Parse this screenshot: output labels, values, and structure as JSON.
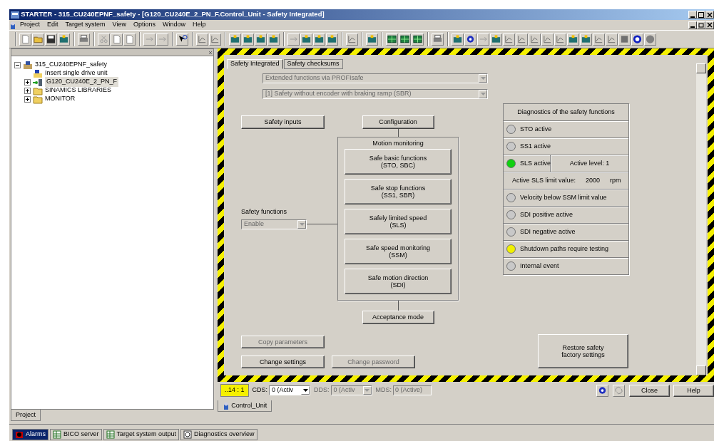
{
  "window": {
    "title": "STARTER - 315_CU240EPNF_safety - [G120_CU240E_2_PN_F.Control_Unit - Safety Integrated]"
  },
  "menu": [
    "Project",
    "Edit",
    "Target system",
    "View",
    "Options",
    "Window",
    "Help"
  ],
  "project_tree": [
    {
      "label": "315_CU240EPNF_safety",
      "kind": "project",
      "expanded": true,
      "selected": false,
      "children": [
        {
          "label": "Insert single drive unit",
          "kind": "insert",
          "selected": false
        },
        {
          "label": "G120_CU240E_2_PN_F",
          "kind": "drive",
          "expanded": false,
          "selected": true
        },
        {
          "label": "SINAMICS LIBRARIES",
          "kind": "folder",
          "expanded": false,
          "selected": false
        },
        {
          "label": "MONITOR",
          "kind": "folder",
          "expanded": false,
          "selected": false
        }
      ]
    }
  ],
  "project_tab": "Project",
  "editor": {
    "tabs": [
      {
        "label": "Safety Integrated",
        "selected": true
      },
      {
        "label": "Safety checksums",
        "selected": false
      }
    ],
    "dropdowns": [
      {
        "value": "Extended functions via PROFIsafe",
        "disabled": true
      },
      {
        "value": "[1] Safety without encoder with braking ramp (SBR)",
        "disabled": true
      }
    ],
    "safety_inputs": {
      "label": "Safety inputs",
      "disabled": false
    },
    "configuration": {
      "label": "Configuration",
      "disabled": false
    },
    "safety_functions": {
      "label": "Safety functions",
      "value": "Enable",
      "disabled": true
    },
    "motion_monitoring": {
      "title": "Motion monitoring",
      "functions": [
        {
          "label": "Safe basic functions",
          "abbr": "(STO, SBC)"
        },
        {
          "label": "Safe stop functions",
          "abbr": "(SS1, SBR)"
        },
        {
          "label": "Safely limited speed",
          "abbr": "(SLS)"
        },
        {
          "label": "Safe speed monitoring",
          "abbr": "(SSM)"
        },
        {
          "label": "Safe motion direction",
          "abbr": "(SDI)"
        }
      ]
    },
    "acceptance_mode": {
      "label": "Acceptance mode",
      "disabled": false
    },
    "diagnostics": {
      "title": "Diagnostics of the safety functions",
      "rows": [
        {
          "kind": "indicator",
          "label": "STO active",
          "color": "#c8c8c8"
        },
        {
          "kind": "indicator",
          "label": "SS1 active",
          "color": "#c8c8c8"
        },
        {
          "kind": "indicator",
          "label": "SLS active",
          "color": "#10d010",
          "extra": "Active level: 1"
        },
        {
          "kind": "limit",
          "label": "Active SLS limit value:",
          "value": "2000",
          "unit": "rpm"
        },
        {
          "kind": "indicator",
          "label": "Velocity below SSM limit value",
          "color": "#c8c8c8"
        },
        {
          "kind": "indicator",
          "label": "SDI positive active",
          "color": "#c8c8c8"
        },
        {
          "kind": "indicator",
          "label": "SDI negative active",
          "color": "#c8c8c8"
        },
        {
          "kind": "indicator",
          "label": "Shutdown paths require testing",
          "color": "#f0f000"
        },
        {
          "kind": "indicator",
          "label": "Internal event",
          "color": "#c8c8c8"
        }
      ]
    },
    "bottom_buttons": [
      {
        "label": "Copy parameters",
        "disabled": true
      },
      {
        "label": "Change settings",
        "disabled": false
      },
      {
        "label": "Change password",
        "disabled": true
      }
    ],
    "restore": {
      "label": "Restore safety factory settings",
      "disabled": false
    }
  },
  "status_bar": {
    "position": "..14 : 1",
    "selectors": [
      {
        "label": "CDS:",
        "value": "0 (Activ",
        "kind": "select",
        "disabled": false
      },
      {
        "label": "DDS:",
        "value": "0 (Activ",
        "kind": "select",
        "disabled": true
      },
      {
        "label": "MDS:",
        "value": "0 (Active)",
        "kind": "field",
        "disabled": true
      }
    ],
    "buttons": [
      "Close",
      "Help"
    ]
  },
  "document_tab": "Control_Unit",
  "taskbar": [
    {
      "label": "Alarms",
      "selected": true
    },
    {
      "label": "BICO server",
      "selected": false
    },
    {
      "label": "Target system output",
      "selected": false
    },
    {
      "label": "Diagnostics overview",
      "selected": false
    }
  ]
}
